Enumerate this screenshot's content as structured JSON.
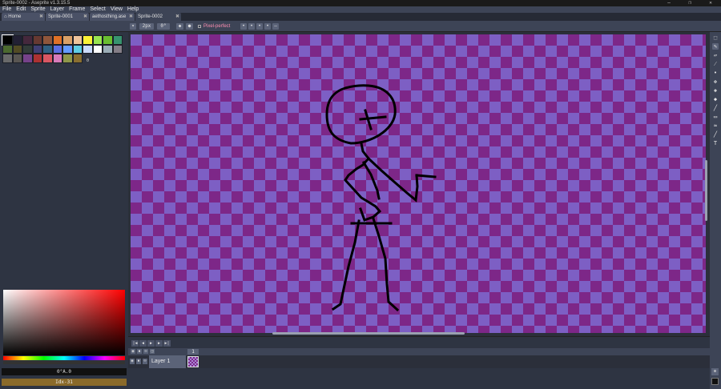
{
  "window": {
    "title": "Sprite-0002 - Aseprite v1.3.15.5",
    "controls": [
      "—",
      "❐",
      "✕"
    ]
  },
  "menu": [
    "File",
    "Edit",
    "Sprite",
    "Layer",
    "Frame",
    "Select",
    "View",
    "Help"
  ],
  "tabs": [
    {
      "label": "⌂ Home",
      "close": "✖"
    },
    {
      "label": "Sprite-0001",
      "close": "✖"
    },
    {
      "label": "aethosthing.ase",
      "close": "✖"
    },
    {
      "label": "Sprite-0002",
      "close": "✖"
    }
  ],
  "toolbar": {
    "brush_size": "2px",
    "angle": "0°",
    "pixel_perfect": "Pixel-perfect"
  },
  "palette": {
    "colors": [
      "#000000",
      "#222034",
      "#45283c",
      "#663931",
      "#8f563b",
      "#df7126",
      "#d9a066",
      "#eec39a",
      "#fbf236",
      "#99e550",
      "#6abe30",
      "#37946e",
      "#4b692f",
      "#524b24",
      "#323c39",
      "#3f3f74",
      "#306082",
      "#5b6ee1",
      "#639bff",
      "#5fcde4",
      "#cbdbfc",
      "#ffffff",
      "#9badb7",
      "#847e87",
      "#696a6a",
      "#595652",
      "#76428a",
      "#ac3232",
      "#d95763",
      "#d77bba",
      "#8f974a",
      "#8a6f30"
    ],
    "selected_index": "0"
  },
  "color": {
    "fg_value": "0°A.0",
    "bg_value": "Idx-31",
    "fg_color": "#000000",
    "bg_color": "#8a6f30"
  },
  "timeline": {
    "frame_number": "1",
    "layer_name": "Layer 1"
  },
  "accent": {
    "canvas_light": "#7d5fc4",
    "canvas_dark": "#7d2788",
    "pixel_perfect_text": "#ff8fb2"
  }
}
